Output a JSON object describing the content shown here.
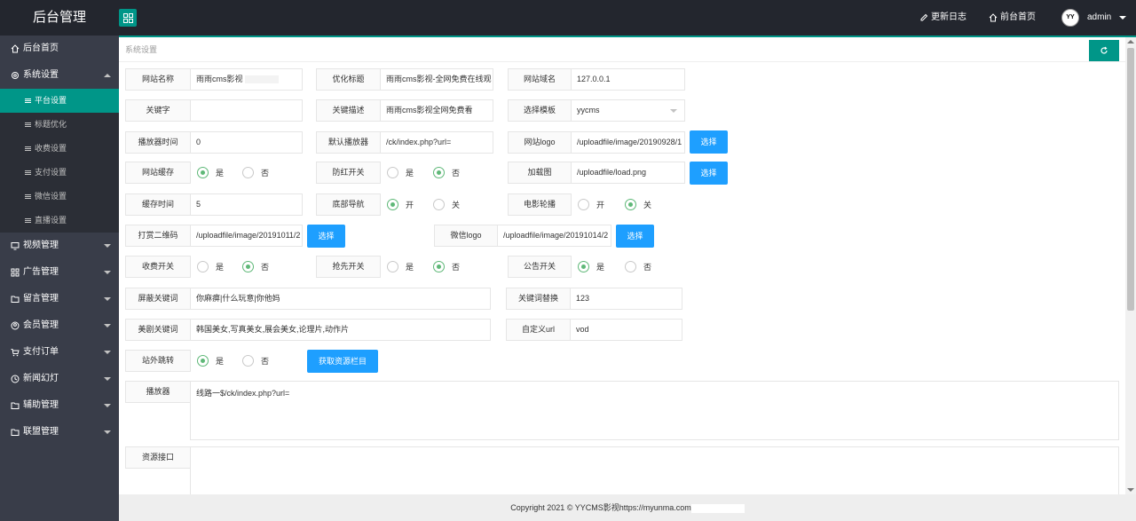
{
  "app": {
    "title": "后台管理"
  },
  "topnav": {
    "changelog": "更新日志",
    "frontpage": "前台首页",
    "avatar_text": "YY",
    "user": "admin"
  },
  "sidebar": {
    "home": "后台首页",
    "system": "系统设置",
    "sub": [
      "平台设置",
      "标题优化",
      "收费设置",
      "支付设置",
      "微信设置",
      "直播设置"
    ],
    "items": [
      "视频管理",
      "广告管理",
      "留言管理",
      "会员管理",
      "支付订单",
      "新闻幻灯",
      "辅助管理",
      "联盟管理"
    ]
  },
  "breadcrumb": "系统设置",
  "form": {
    "site_name": {
      "label": "网站名称",
      "value": "雨雨cms影视"
    },
    "seo_title": {
      "label": "优化标题",
      "value": "雨雨cms影视-全网免费在线观"
    },
    "domain": {
      "label": "网站域名",
      "value": "127.0.0.1"
    },
    "keywords": {
      "label": "关键字",
      "value": ""
    },
    "description": {
      "label": "关键描述",
      "value": "雨雨cms影视全网免费看"
    },
    "template": {
      "label": "选择模板",
      "value": "yycms"
    },
    "player_time": {
      "label": "播放器时间",
      "value": "0"
    },
    "default_player": {
      "label": "默认播放器",
      "value": "/ck/index.php?url="
    },
    "site_logo": {
      "label": "网站logo",
      "value": "/uploadfile/image/20190928/1"
    },
    "site_cache": {
      "label": "网站缓存",
      "opt_yes": "是",
      "opt_no": "否",
      "selected": "是"
    },
    "anti_red": {
      "label": "防红开关",
      "opt_yes": "是",
      "opt_no": "否",
      "selected": "否"
    },
    "loading_img": {
      "label": "加载图",
      "value": "/uploadfile/load.png"
    },
    "cache_time": {
      "label": "缓存时间",
      "value": "5"
    },
    "bottom_nav": {
      "label": "底部导航",
      "opt_on": "开",
      "opt_off": "关",
      "selected": "开"
    },
    "carousel": {
      "label": "电影轮播",
      "opt_on": "开",
      "opt_off": "关",
      "selected": "关"
    },
    "reward_qr": {
      "label": "打赏二维码",
      "value": "/uploadfile/image/20191011/2"
    },
    "wechat_logo": {
      "label": "微信logo",
      "value": "/uploadfile/image/20191014/2"
    },
    "charge": {
      "label": "收费开关",
      "opt_yes": "是",
      "opt_no": "否",
      "selected": "否"
    },
    "first_look": {
      "label": "抢先开关",
      "opt_yes": "是",
      "opt_no": "否",
      "selected": "否"
    },
    "notice": {
      "label": "公告开关",
      "opt_yes": "是",
      "opt_no": "否",
      "selected": "是"
    },
    "block_words": {
      "label": "屏蔽关键词",
      "value": "你麻痹|什么玩意|你他妈"
    },
    "replace_words": {
      "label": "关键词替换",
      "value": "123"
    },
    "beauty_words": {
      "label": "美剧关键词",
      "value": "韩国美女,写真美女,展会美女,论理片,动作片"
    },
    "custom_url": {
      "label": "自定义url",
      "value": "vod"
    },
    "external_jump": {
      "label": "站外跳转",
      "opt_yes": "是",
      "opt_no": "否",
      "selected": "是"
    },
    "get_resource_btn": "获取资源栏目",
    "player": {
      "label": "播放器",
      "value": "线路一$/ck/index.php?url="
    },
    "resource_api": {
      "label": "资源接口",
      "value": ""
    },
    "select_btn": "选择"
  },
  "footer": {
    "text": "Copyright 2021 © YYCMS影视https://myunma.com"
  },
  "colors": {
    "accent": "#009688",
    "blue_button": "#1e9fff",
    "radio_on": "#5fb878",
    "sidebar_bg": "#393d49",
    "topbar_bg": "#23262e"
  }
}
